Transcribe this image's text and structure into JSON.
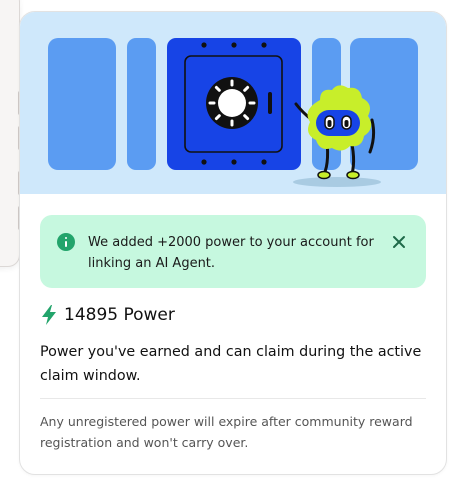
{
  "alert": {
    "message": "We added +2000 power to your account for linking an AI Agent."
  },
  "power": {
    "value": "14895 Power"
  },
  "description": "Power you've earned and can claim during the active claim window.",
  "note": "Any unregistered power will expire after community reward registration and won't carry over.",
  "colors": {
    "hero_background": "#cfe8fb",
    "panel_blue": "#5b9cf2",
    "vault_blue": "#1744e6",
    "mascot_green": "#c8ee2a",
    "alert_background": "#c6f8df",
    "accent_green": "#22a46b"
  },
  "icons": {
    "alert": "info-icon",
    "close": "close-icon",
    "power": "lightning-bolt-icon"
  }
}
